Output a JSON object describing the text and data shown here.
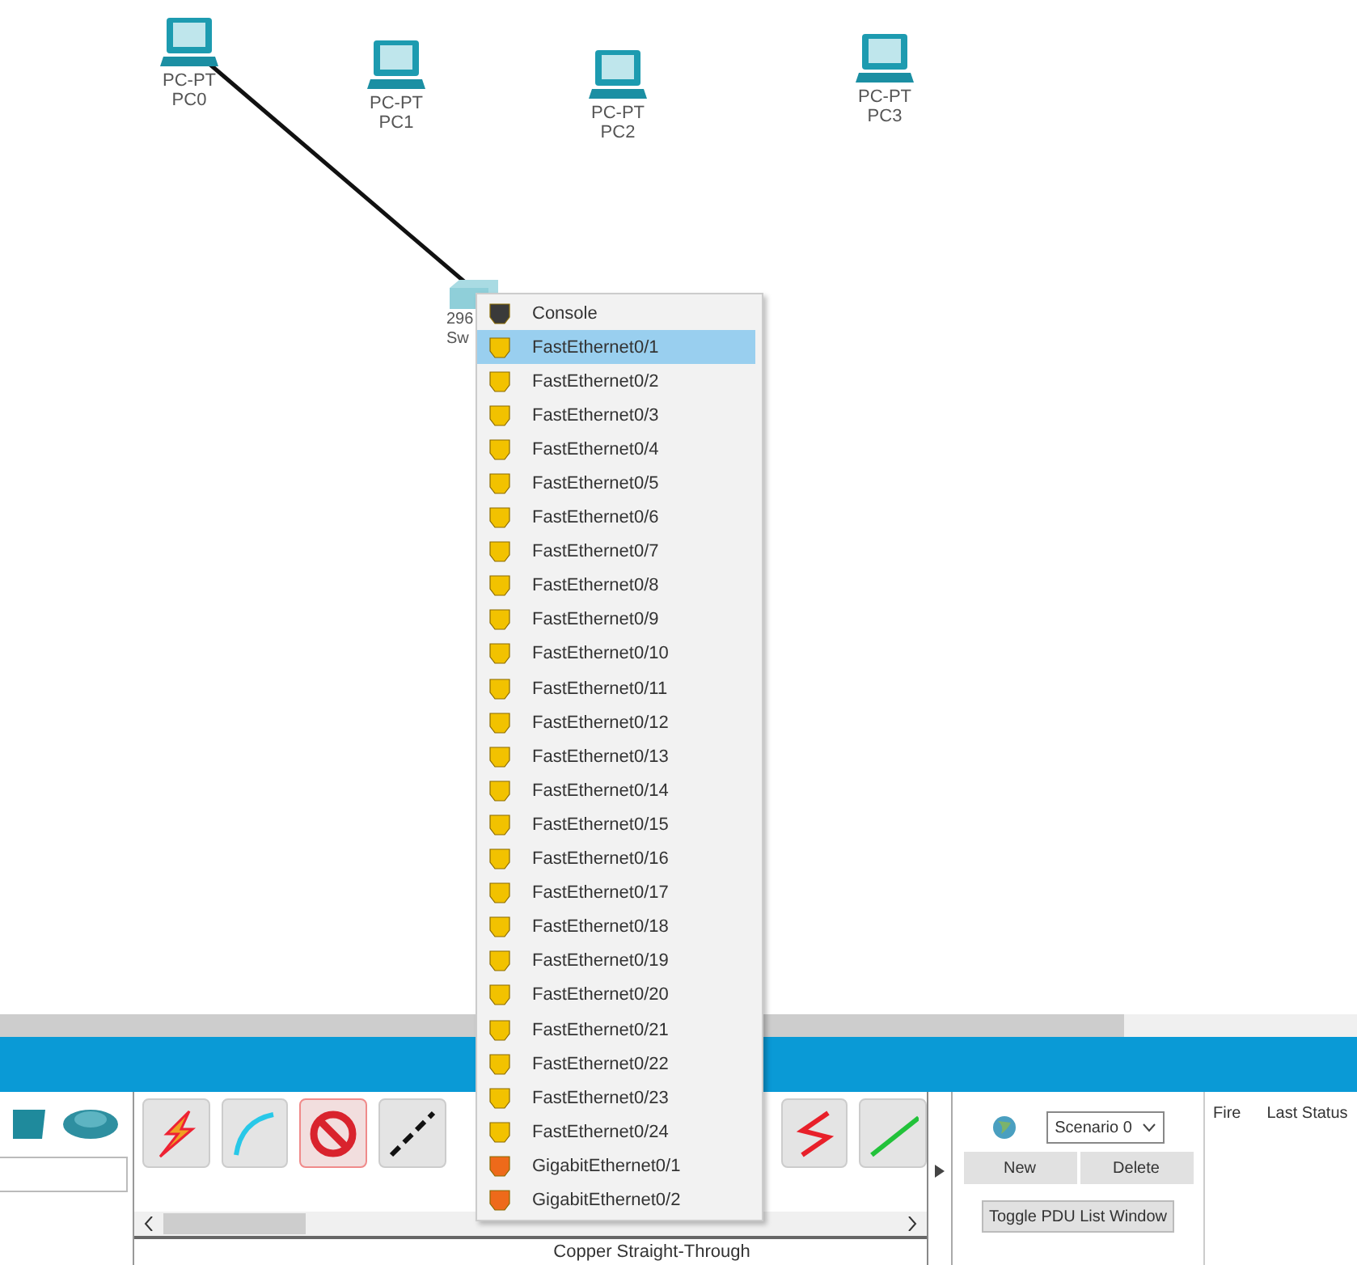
{
  "canvas": {
    "devices": [
      {
        "model": "PC-PT",
        "name": "PC0"
      },
      {
        "model": "PC-PT",
        "name": "PC1"
      },
      {
        "model": "PC-PT",
        "name": "PC2"
      },
      {
        "model": "PC-PT",
        "name": "PC3"
      }
    ],
    "switch": {
      "model": "296",
      "name": "Sw"
    }
  },
  "port_menu": {
    "items": [
      {
        "label": "Console",
        "kind": "console",
        "selected": false
      },
      {
        "label": "FastEthernet0/1",
        "kind": "fast",
        "selected": true
      },
      {
        "label": "FastEthernet0/2",
        "kind": "fast",
        "selected": false
      },
      {
        "label": "FastEthernet0/3",
        "kind": "fast",
        "selected": false
      },
      {
        "label": "FastEthernet0/4",
        "kind": "fast",
        "selected": false
      },
      {
        "label": "FastEthernet0/5",
        "kind": "fast",
        "selected": false
      },
      {
        "label": "FastEthernet0/6",
        "kind": "fast",
        "selected": false
      },
      {
        "label": "FastEthernet0/7",
        "kind": "fast",
        "selected": false
      },
      {
        "label": "FastEthernet0/8",
        "kind": "fast",
        "selected": false
      },
      {
        "label": "FastEthernet0/9",
        "kind": "fast",
        "selected": false
      },
      {
        "label": "FastEthernet0/10",
        "kind": "fast",
        "selected": false
      },
      {
        "label": "FastEthernet0/11",
        "kind": "fast",
        "selected": false
      },
      {
        "label": "FastEthernet0/12",
        "kind": "fast",
        "selected": false
      },
      {
        "label": "FastEthernet0/13",
        "kind": "fast",
        "selected": false
      },
      {
        "label": "FastEthernet0/14",
        "kind": "fast",
        "selected": false
      },
      {
        "label": "FastEthernet0/15",
        "kind": "fast",
        "selected": false
      },
      {
        "label": "FastEthernet0/16",
        "kind": "fast",
        "selected": false
      },
      {
        "label": "FastEthernet0/17",
        "kind": "fast",
        "selected": false
      },
      {
        "label": "FastEthernet0/18",
        "kind": "fast",
        "selected": false
      },
      {
        "label": "FastEthernet0/19",
        "kind": "fast",
        "selected": false
      },
      {
        "label": "FastEthernet0/20",
        "kind": "fast",
        "selected": false
      },
      {
        "label": "FastEthernet0/21",
        "kind": "fast",
        "selected": false
      },
      {
        "label": "FastEthernet0/22",
        "kind": "fast",
        "selected": false
      },
      {
        "label": "FastEthernet0/23",
        "kind": "fast",
        "selected": false
      },
      {
        "label": "FastEthernet0/24",
        "kind": "fast",
        "selected": false
      },
      {
        "label": "GigabitEthernet0/1",
        "kind": "gigabit",
        "selected": false
      },
      {
        "label": "GigabitEthernet0/2",
        "kind": "gigabit",
        "selected": false
      }
    ]
  },
  "cables": [
    {
      "kind": "lightning",
      "selected": false
    },
    {
      "kind": "curve",
      "selected": false
    },
    {
      "kind": "forbidden",
      "selected": true
    },
    {
      "kind": "dashed",
      "selected": false
    },
    {
      "kind": "zigzag",
      "selected": false
    },
    {
      "kind": "straight",
      "selected": false
    }
  ],
  "cable_caption": "Copper Straight-Through",
  "scenario": {
    "select": "Scenario 0",
    "buttons": [
      "New",
      "Delete"
    ],
    "toggle": "Toggle PDU List Window"
  },
  "pdu_columns": [
    "Fire",
    "Last Status"
  ]
}
